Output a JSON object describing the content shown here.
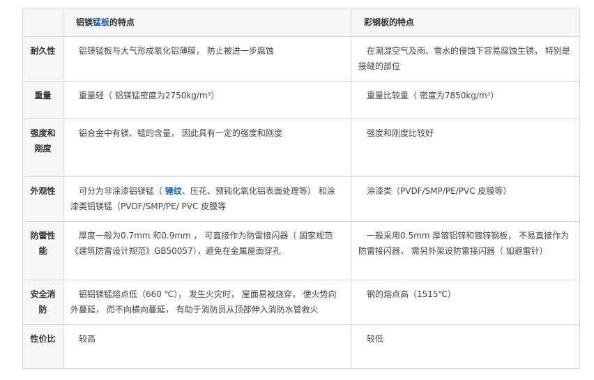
{
  "header": {
    "corner": "",
    "al_prefix": "铝镁",
    "al_keyword": "锰板",
    "al_suffix": "的特点",
    "steel_title": "彩钢板的特点"
  },
  "rows": [
    {
      "label": "耐久性",
      "al": "铝镁锰板与大气形成氧化铝薄膜， 防止被进一步腐蚀",
      "steel": "在潮湿空气及雨、雪水的侵蚀下容易腐蚀生锈， 特别是接缝的部位"
    },
    {
      "label": "重量",
      "al": "重量轻（ 铝镁锰密度为2750kg/m³）",
      "steel": "重量比较重（ 密度为7850kg/m³）"
    },
    {
      "label": "强度和刚度",
      "al": "铝合金中有镁、锰的含量， 因此具有一定的强度和刚度",
      "steel": "强度和刚度比较好"
    },
    {
      "label": "外观性",
      "al_before": "可分为非涂漆铝镁锰（ ",
      "al_keyword": "锤纹",
      "al_after": "、压花、预钝化氧化铝表面处理等） 和涂漆类铝镁锰（PVDF/SMP/PE/ PVC 皮膜等",
      "steel": "涂漆类（PVDF/SMP/PE/PVC 皮膜等）"
    },
    {
      "label": "防雷性能",
      "al": "厚度一般为0.7mm 和0.9mm ， 可直接作为防雷接闪器（ 国家规范《建筑防雷设计规范》GB50057），避免在金属屋面穿孔",
      "steel": "一般采用0.5mm 厚镀铝锌和镀锌钢板， 不易直接作为防雷接闪器， 需另外架设防雷接闪器（ 如避雷针）"
    },
    {
      "label": "安全消防",
      "al": "铝铝镁锰熔点低（660 ℃）， 发生火灾时， 屋面易被烧穿， 使火势向外蔓延， 而不向横向蔓延， 有助于消防员从顶部伸入消防水管救火",
      "steel": "钢的熔点高（1515℃）"
    },
    {
      "label": "性价比",
      "al": "较高",
      "steel": "较低"
    }
  ],
  "colors": {
    "border": "#d6d6d6",
    "label_bg": "#f6f6f6",
    "text": "#444444",
    "keyword": "#1a5fa8"
  }
}
